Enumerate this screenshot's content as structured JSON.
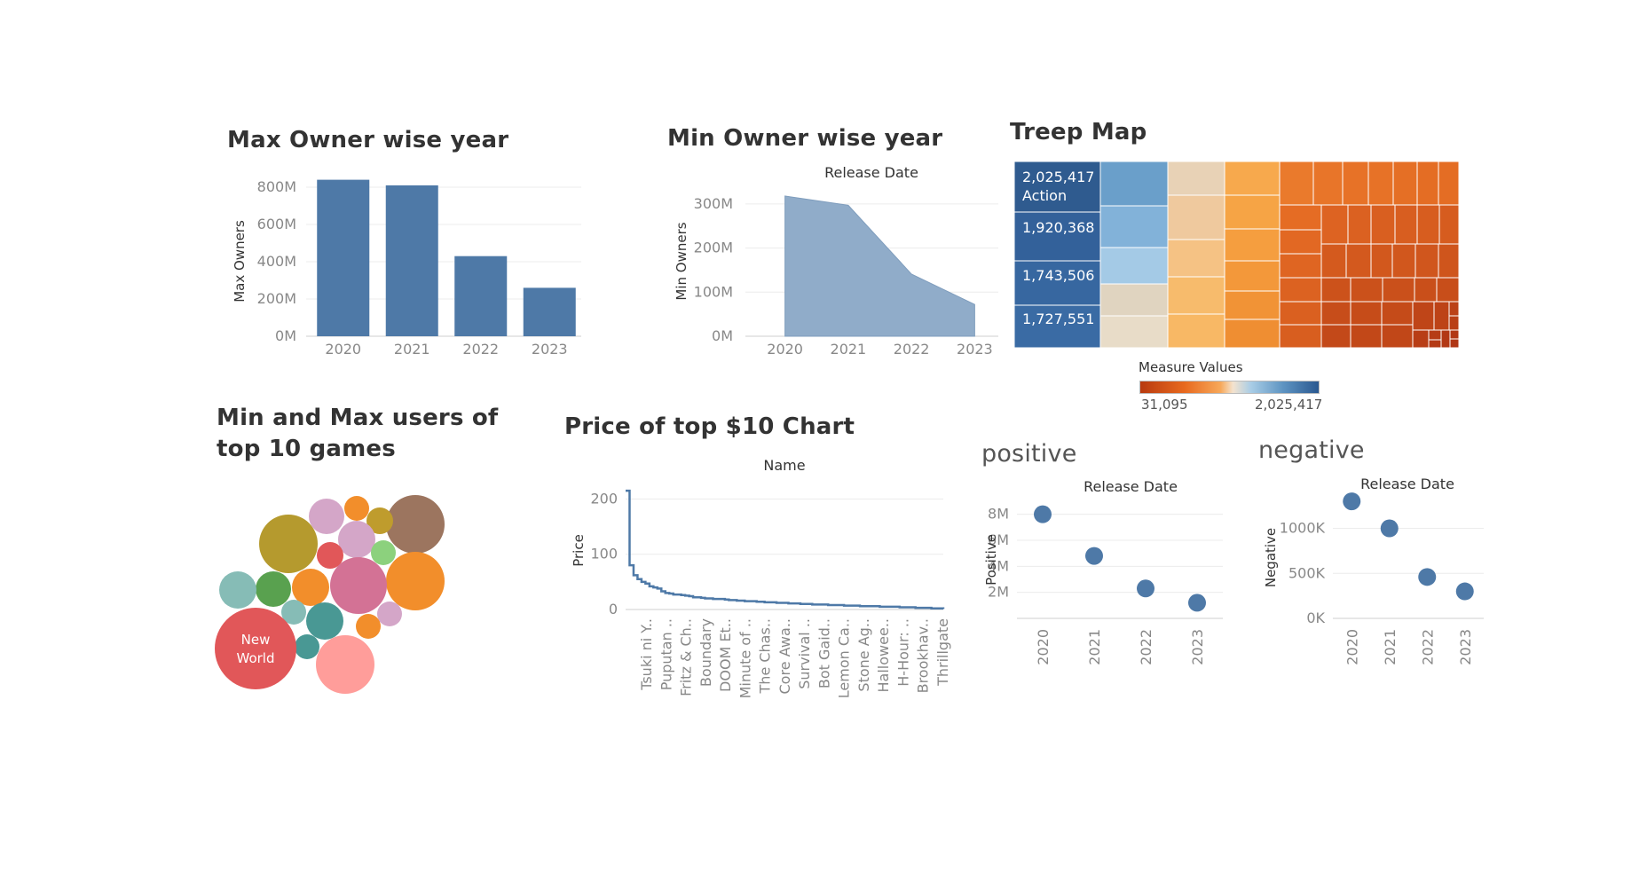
{
  "colors": {
    "bar": "#4e79a7",
    "area": "#90acc9",
    "line": "#4e79a7",
    "dot": "#4e79a7"
  },
  "chart_data": [
    {
      "id": "max_owner",
      "type": "bar",
      "title": "Max Owner wise year",
      "xlabel": "",
      "ylabel": "Max Owners",
      "categories": [
        "2020",
        "2021",
        "2022",
        "2023"
      ],
      "values": [
        840,
        810,
        430,
        260
      ],
      "unit": "M",
      "yticks": [
        "0M",
        "200M",
        "400M",
        "600M",
        "800M"
      ],
      "ylim": [
        0,
        900
      ]
    },
    {
      "id": "min_owner",
      "type": "area",
      "title": "Min Owner wise year",
      "header": "Release Date",
      "ylabel": "Min Owners",
      "categories": [
        "2020",
        "2021",
        "2022",
        "2023"
      ],
      "values": [
        318,
        297,
        141,
        72
      ],
      "unit": "M",
      "yticks": [
        "0M",
        "100M",
        "200M",
        "300M"
      ],
      "ylim": [
        0,
        340
      ]
    },
    {
      "id": "tree_map",
      "type": "treemap",
      "title": "Treep Map",
      "labels": [
        {
          "value": "2,025,417",
          "name": "Action"
        },
        {
          "value": "1,920,368"
        },
        {
          "value": "1,743,506"
        },
        {
          "value": "1,727,551"
        }
      ],
      "legend": {
        "title": "Measure Values",
        "min": "31,095",
        "max": "2,025,417"
      }
    },
    {
      "id": "bubbles",
      "type": "bubble",
      "title_lines": [
        "Min and Max users of",
        "top 10 games"
      ],
      "labelled": {
        "line1": "New",
        "line2": "World"
      },
      "bubble_colors": [
        "#e15759",
        "#ff9d9a",
        "#b59a2e",
        "#f28e2b",
        "#9c755f",
        "#d37295",
        "#86bcb6",
        "#59a14f",
        "#499894",
        "#d4a6c8",
        "#8cd17d",
        "#f28e2b",
        "#bf9c2d",
        "#e15759",
        "#fabfd2"
      ]
    },
    {
      "id": "price",
      "type": "line",
      "title": "Price of top $10 Chart",
      "header": "Name",
      "ylabel": "Price",
      "yticks": [
        "0",
        "100",
        "200"
      ],
      "ylim": [
        0,
        220
      ],
      "values": [
        215,
        80,
        62,
        55,
        50,
        47,
        42,
        40,
        38,
        33,
        30,
        29,
        27,
        27,
        26,
        25,
        24,
        22,
        22,
        21,
        20,
        20,
        19,
        19,
        19,
        18,
        17,
        17,
        16,
        16,
        15,
        15,
        15,
        14,
        14,
        13,
        13,
        13,
        12,
        12,
        12,
        11,
        11,
        11,
        10,
        10,
        10,
        9,
        9,
        9,
        9,
        8,
        8,
        8,
        8,
        7,
        7,
        7,
        7,
        6,
        6,
        6,
        6,
        6,
        5,
        5,
        5,
        5,
        5,
        4,
        4,
        4,
        4,
        3,
        3,
        3,
        3,
        2,
        2,
        2,
        1
      ],
      "xticks": [
        "Tsuki ni Y..",
        "Puputan ..",
        "Fritz & Ch..",
        "Boundary",
        "DOOM Et..",
        "Minute of ..",
        "The Chas..",
        "Core Awa..",
        "Survival ..",
        "Bot Gaid..",
        "Lemon Ca..",
        "Stone Ag..",
        "Hallowee..",
        "H-Hour: ..",
        "Brookhav..",
        "Thrillgate"
      ]
    },
    {
      "id": "positive",
      "type": "scatter",
      "title": "positive",
      "header": "Release Date",
      "ylabel": "Positive",
      "categories": [
        "2020",
        "2021",
        "2022",
        "2023"
      ],
      "values": [
        8.0,
        4.8,
        2.3,
        1.2
      ],
      "unit": "M",
      "yticks": [
        "2M",
        "4M",
        "6M",
        "8M"
      ],
      "ylim": [
        0,
        9
      ]
    },
    {
      "id": "negative",
      "type": "scatter",
      "title": "negative",
      "header": "Release Date",
      "ylabel": "Negative",
      "categories": [
        "2020",
        "2021",
        "2022",
        "2023"
      ],
      "values": [
        1300,
        1000,
        460,
        300
      ],
      "unit": "K",
      "yticks": [
        "0K",
        "500K",
        "1000K"
      ],
      "ylim": [
        0,
        1350
      ]
    }
  ]
}
